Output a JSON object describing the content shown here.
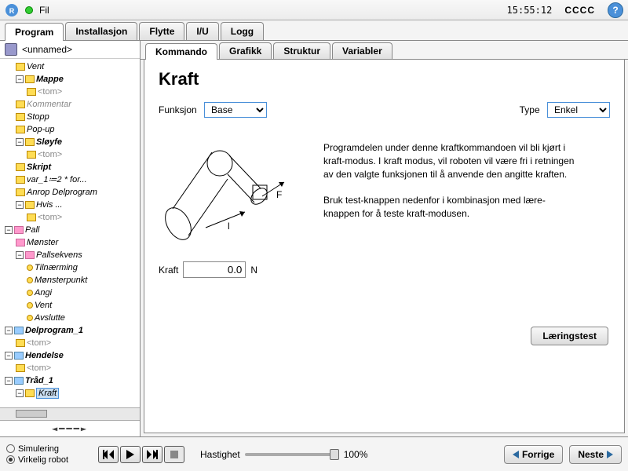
{
  "topbar": {
    "menu_fil": "Fil",
    "time": "15:55:12",
    "cccc": "CCCC"
  },
  "maintabs": [
    "Program",
    "Installasjon",
    "Flytte",
    "I/U",
    "Logg"
  ],
  "maintab_active": 0,
  "sidebar": {
    "filename": "<unnamed>"
  },
  "tree": {
    "vent": "Vent",
    "mappe": "Mappe",
    "tom": "<tom>",
    "kommentar": "Kommentar",
    "stopp": "Stopp",
    "popup": "Pop-up",
    "sloyfe": "Sløyfe",
    "skript": "Skript",
    "var1": "var_1≔2 * for...",
    "anrop": "Anrop Delprogram",
    "hvis": "Hvis ...",
    "pall": "Pall",
    "monster": "Mønster",
    "pallsekvens": "Pallsekvens",
    "tilnaerming": "Tilnærming",
    "monsterpunkt": "Mønsterpunkt",
    "angi": "Angi",
    "vent2": "Vent",
    "avslutte": "Avslutte",
    "delprogram": "Delprogram_1",
    "hendelse": "Hendelse",
    "trad": "Tråd_1",
    "kraft": "Kraft"
  },
  "navarrows": "◄━━━►",
  "subtabs": [
    "Kommando",
    "Grafikk",
    "Struktur",
    "Variabler"
  ],
  "subtab_active": 0,
  "panel": {
    "title": "Kraft",
    "funksjon_label": "Funksjon",
    "funksjon_value": "Base",
    "type_label": "Type",
    "type_value": "Enkel",
    "desc1": "Programdelen under denne kraftkommandoen vil bli kjørt i kraft-modus. I kraft modus, vil roboten vil være fri i retningen",
    "desc2": "av den valgte funksjonen til å anvende den angitte kraften.",
    "desc3": "Bruk test-knappen nedenfor i kombinasjon med lære-knappen for å teste kraft-modusen.",
    "kraft_label": "Kraft",
    "kraft_value": "0.0",
    "kraft_unit": "N",
    "learn_btn": "Læringstest"
  },
  "footer": {
    "simulering": "Simulering",
    "virkelig": "Virkelig robot",
    "hastighet_label": "Hastighet",
    "hastighet_value": "100%",
    "forrige": "Forrige",
    "neste": "Neste"
  },
  "chart_data": {
    "type": "diagram",
    "note": "Robot arm schematic with force vector F and direction l"
  }
}
